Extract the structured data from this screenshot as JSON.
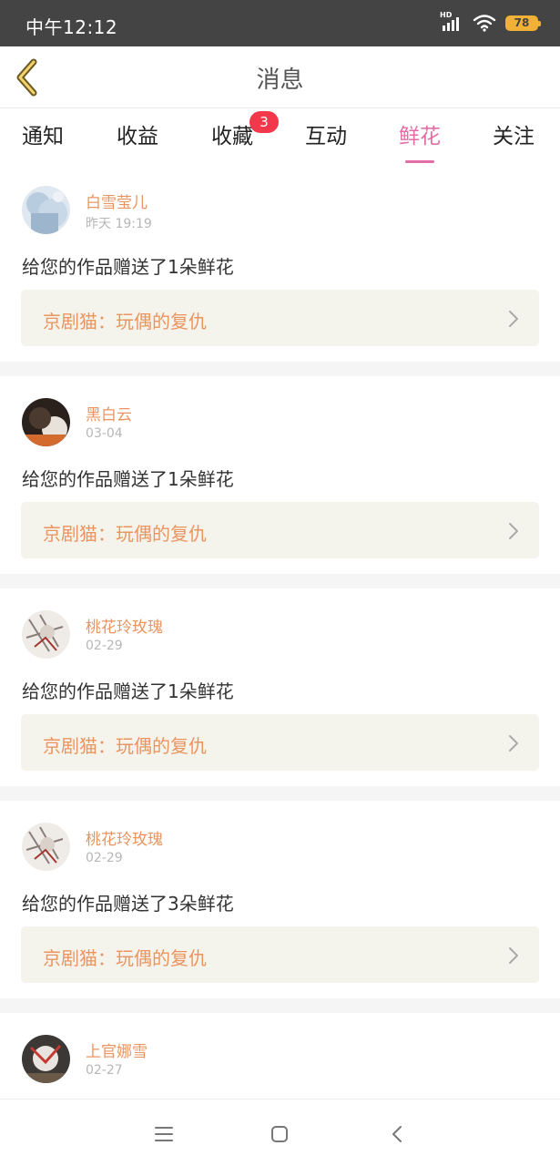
{
  "status_bar": {
    "time": "中午12:12",
    "network": "HD",
    "battery": "78"
  },
  "header": {
    "title": "消息"
  },
  "tabs": [
    {
      "label": "通知"
    },
    {
      "label": "收益"
    },
    {
      "label": "收藏",
      "badge": "3"
    },
    {
      "label": "互动"
    },
    {
      "label": "鲜花",
      "active": true
    },
    {
      "label": "关注"
    }
  ],
  "messages": [
    {
      "username": "白雪莹儿",
      "time": "昨天 19:19",
      "text": "给您的作品赠送了1朵鲜花",
      "work": "京剧猫：玩偶的复仇"
    },
    {
      "username": "黑白云",
      "time": "03-04",
      "text": "给您的作品赠送了1朵鲜花",
      "work": "京剧猫：玩偶的复仇"
    },
    {
      "username": "桃花玲玫瑰",
      "time": "02-29",
      "text": "给您的作品赠送了1朵鲜花",
      "work": "京剧猫：玩偶的复仇"
    },
    {
      "username": "桃花玲玫瑰",
      "time": "02-29",
      "text": "给您的作品赠送了3朵鲜花",
      "work": "京剧猫：玩偶的复仇"
    },
    {
      "username": "上官娜雪",
      "time": "02-27"
    }
  ],
  "colors": {
    "accent_pink": "#e36da6",
    "orange_text": "#ea9560",
    "badge_red": "#f2384a",
    "status_bar": "#444444"
  },
  "icons": {
    "back": "chevron-left-icon",
    "link": "chevron-right-icon",
    "nav_menu": "menu-icon",
    "nav_home": "square-icon",
    "nav_back": "back-icon"
  }
}
